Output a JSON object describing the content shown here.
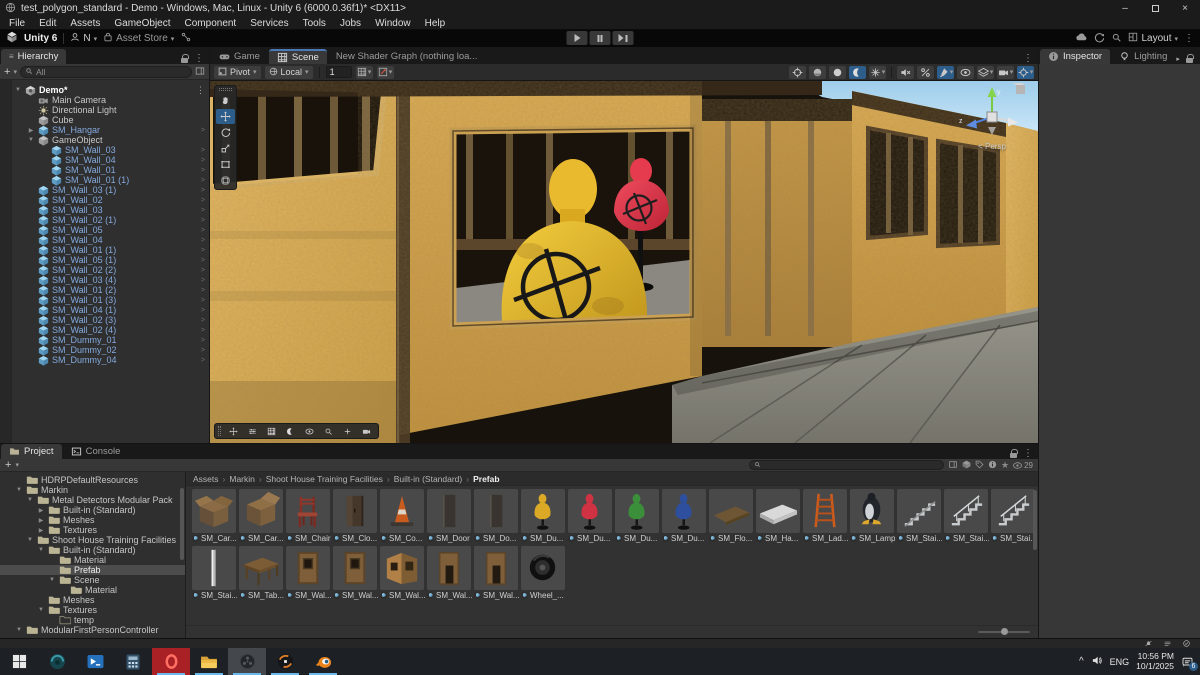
{
  "window": {
    "title": "test_polygon_standard - Demo - Windows, Mac, Linux - Unity 6 (6000.0.36f1)* <DX11>"
  },
  "menu": [
    "File",
    "Edit",
    "Assets",
    "GameObject",
    "Component",
    "Services",
    "Tools",
    "Jobs",
    "Window",
    "Help"
  ],
  "topbar": {
    "product": "Unity 6",
    "account_initial": "N",
    "asset_store_label": "Asset Store",
    "layout_label": "Layout"
  },
  "glyphs": {
    "caret": "▾",
    "kebab": "⋮",
    "menu_lines": "≡",
    "plus": "+",
    "chev": ">",
    "crumb_sep": "›",
    "minimize": "–",
    "close": "×",
    "expand_open": "▼",
    "expand_closed": "▶",
    "arrow_right_small": "▸",
    "tray_chevron": "^",
    "star": "★"
  },
  "colors": {
    "accent_blue": "#2d5d8b",
    "prefab_text": "#84aade",
    "selection_gray": "#4c4c4c",
    "osb_wood": "#d8a94f",
    "dummy_yellow": "#e8b92e",
    "dummy_red": "#e23a4c",
    "taskbar_underline": "#6cb8e8",
    "opera_red": "#a92025",
    "sky": "#a8d4ee"
  },
  "hierarchy": {
    "tab": "Hierarchy",
    "search_filter": "All",
    "rows": [
      {
        "label": "Demo*",
        "depth": 0,
        "kind": "scene",
        "exp": "open"
      },
      {
        "label": "Main Camera",
        "depth": 1,
        "kind": "camera"
      },
      {
        "label": "Directional Light",
        "depth": 1,
        "kind": "light"
      },
      {
        "label": "Cube",
        "depth": 1,
        "kind": "cube"
      },
      {
        "label": "SM_Hangar",
        "depth": 1,
        "kind": "prefab",
        "exp": "closed"
      },
      {
        "label": "GameObject",
        "depth": 1,
        "kind": "cube",
        "exp": "open"
      },
      {
        "label": "SM_Wall_03",
        "depth": 2,
        "kind": "prefab"
      },
      {
        "label": "SM_Wall_04",
        "depth": 2,
        "kind": "prefab"
      },
      {
        "label": "SM_Wall_01",
        "depth": 2,
        "kind": "prefab"
      },
      {
        "label": "SM_Wall_01 (1)",
        "depth": 2,
        "kind": "prefab"
      },
      {
        "label": "SM_Wall_03 (1)",
        "depth": 1,
        "kind": "prefab"
      },
      {
        "label": "SM_Wall_02",
        "depth": 1,
        "kind": "prefab"
      },
      {
        "label": "SM_Wall_03",
        "depth": 1,
        "kind": "prefab"
      },
      {
        "label": "SM_Wall_02 (1)",
        "depth": 1,
        "kind": "prefab"
      },
      {
        "label": "SM_Wall_05",
        "depth": 1,
        "kind": "prefab"
      },
      {
        "label": "SM_Wall_04",
        "depth": 1,
        "kind": "prefab"
      },
      {
        "label": "SM_Wall_01 (1)",
        "depth": 1,
        "kind": "prefab"
      },
      {
        "label": "SM_Wall_05 (1)",
        "depth": 1,
        "kind": "prefab"
      },
      {
        "label": "SM_Wall_02 (2)",
        "depth": 1,
        "kind": "prefab"
      },
      {
        "label": "SM_Wall_03 (4)",
        "depth": 1,
        "kind": "prefab"
      },
      {
        "label": "SM_Wall_01 (2)",
        "depth": 1,
        "kind": "prefab"
      },
      {
        "label": "SM_Wall_01 (3)",
        "depth": 1,
        "kind": "prefab"
      },
      {
        "label": "SM_Wall_04 (1)",
        "depth": 1,
        "kind": "prefab"
      },
      {
        "label": "SM_Wall_02 (3)",
        "depth": 1,
        "kind": "prefab"
      },
      {
        "label": "SM_Wall_02 (4)",
        "depth": 1,
        "kind": "prefab"
      },
      {
        "label": "SM_Dummy_01",
        "depth": 1,
        "kind": "prefab"
      },
      {
        "label": "SM_Dummy_02",
        "depth": 1,
        "kind": "prefab"
      },
      {
        "label": "SM_Dummy_04",
        "depth": 1,
        "kind": "prefab"
      }
    ]
  },
  "scene": {
    "tabs": [
      {
        "label": "Game",
        "icon": "game"
      },
      {
        "label": "Scene",
        "icon": "scenegrid",
        "active": true
      },
      {
        "label": "New Shader Graph (nothing loa...",
        "icon": ""
      }
    ],
    "pivot": "Pivot",
    "local": "Local",
    "snap": "1",
    "persp": "< Persp",
    "axis_y": "y",
    "axis_z": "z",
    "tools": [
      {
        "icon": "hand",
        "name": "view-tool"
      },
      {
        "icon": "move",
        "name": "move-tool",
        "active": true
      },
      {
        "icon": "rotate",
        "name": "rotate-tool"
      },
      {
        "icon": "scale",
        "name": "scale-tool"
      },
      {
        "icon": "rectt",
        "name": "rect-tool"
      },
      {
        "icon": "transform",
        "name": "transform-tool"
      }
    ],
    "right_icons": [
      {
        "icon": "crosshair",
        "name": "frame-debug-toggle"
      },
      {
        "icon": "sphere",
        "name": "shading-mode-toggle"
      },
      {
        "icon": "circle",
        "name": "light-probe-toggle"
      },
      {
        "icon": "moon",
        "name": "scene-lighting-toggle",
        "active": true
      },
      {
        "icon": "starfx",
        "name": "effects-toggle",
        "dd": true
      },
      {
        "sep": true
      },
      {
        "icon": "mute",
        "name": "audio-toggle"
      },
      {
        "icon": "cutoff",
        "name": "component-cull-toggle"
      },
      {
        "icon": "brush",
        "name": "overlay-paint-toggle",
        "active": true,
        "dd": true
      },
      {
        "icon": "eye",
        "name": "scene-visibility-toggle"
      },
      {
        "icon": "layers",
        "name": "layers-menu",
        "dd": true
      },
      {
        "icon": "camera",
        "name": "camera-settings-menu",
        "dd": true
      },
      {
        "icon": "gizmodot",
        "name": "gizmos-menu",
        "active": true,
        "dd": true
      }
    ],
    "bottom_icons": [
      {
        "icon": "move",
        "name": "overlay-move"
      },
      {
        "icon": "sliders",
        "name": "overlay-properties"
      },
      {
        "icon": "grid",
        "name": "overlay-grid"
      },
      {
        "icon": "moon",
        "name": "overlay-lighting"
      },
      {
        "icon": "eye",
        "name": "overlay-visibility"
      },
      {
        "icon": "magnifier",
        "name": "overlay-zoom"
      },
      {
        "icon": "pan",
        "name": "overlay-pan"
      },
      {
        "icon": "camera",
        "name": "overlay-camera"
      }
    ]
  },
  "inspector": {
    "tabs": [
      {
        "label": "Inspector",
        "icon": "info",
        "active": true
      },
      {
        "label": "Lighting",
        "icon": "bulb"
      }
    ]
  },
  "project": {
    "tabs": [
      {
        "label": "Project",
        "icon": "folder",
        "active": true
      },
      {
        "label": "Console",
        "icon": "console"
      }
    ],
    "hidden_count": "29",
    "breadcrumb": [
      "Assets",
      "Markin",
      "Shoot House Training Facilities",
      "Built-in (Standard)",
      "Prefab"
    ],
    "tree": [
      {
        "label": "HDRPDefaultResources",
        "depth": 1,
        "kind": "folder"
      },
      {
        "label": "Markin",
        "depth": 1,
        "kind": "folder",
        "exp": "open"
      },
      {
        "label": "Metal Detectors Modular Pack",
        "depth": 2,
        "kind": "folder",
        "exp": "open"
      },
      {
        "label": "Built-in (Standard)",
        "depth": 3,
        "kind": "folder",
        "exp": "closed"
      },
      {
        "label": "Meshes",
        "depth": 3,
        "kind": "folder",
        "exp": "closed"
      },
      {
        "label": "Textures",
        "depth": 3,
        "kind": "folder",
        "exp": "closed"
      },
      {
        "label": "Shoot House Training Facilities",
        "depth": 2,
        "kind": "folder",
        "exp": "open"
      },
      {
        "label": "Built-in (Standard)",
        "depth": 3,
        "kind": "folder",
        "exp": "open"
      },
      {
        "label": "Material",
        "depth": 4,
        "kind": "folder"
      },
      {
        "label": "Prefab",
        "depth": 4,
        "kind": "folder",
        "selected": true
      },
      {
        "label": "Scene",
        "depth": 4,
        "kind": "folder",
        "exp": "open"
      },
      {
        "label": "Material",
        "depth": 5,
        "kind": "folder"
      },
      {
        "label": "Meshes",
        "depth": 3,
        "kind": "folder"
      },
      {
        "label": "Textures",
        "depth": 3,
        "kind": "folder",
        "exp": "open"
      },
      {
        "label": "temp",
        "depth": 4,
        "kind": "folder-empty"
      },
      {
        "label": "ModularFirstPersonController",
        "depth": 1,
        "kind": "folder",
        "exp": "open"
      }
    ],
    "grid": [
      [
        {
          "label": "SM_Car...",
          "kind": "box-open"
        },
        {
          "label": "SM_Car...",
          "kind": "box-flaps"
        },
        {
          "label": "SM_Chair",
          "kind": "chair"
        },
        {
          "label": "SM_Clo...",
          "kind": "closet"
        },
        {
          "label": "SM_Co...",
          "kind": "cone"
        },
        {
          "label": "SM_Door",
          "kind": "door"
        },
        {
          "label": "SM_Do...",
          "kind": "door"
        },
        {
          "label": "SM_Du...",
          "kind": "dummy-yellow"
        },
        {
          "label": "SM_Du...",
          "kind": "dummy-red"
        },
        {
          "label": "SM_Du...",
          "kind": "dummy-green"
        },
        {
          "label": "SM_Du...",
          "kind": "dummy-blue"
        },
        {
          "label": "SM_Flo...",
          "kind": "floorp"
        },
        {
          "label": "SM_Ha...",
          "kind": "platform"
        },
        {
          "label": "SM_Lad...",
          "kind": "ladder"
        },
        {
          "label": "SM_Lamp",
          "kind": "lamp"
        },
        {
          "label": "SM_Stai...",
          "kind": "stairs"
        },
        {
          "label": "SM_Stai...",
          "kind": "stairs-rail"
        },
        {
          "label": "SM_Stai...",
          "kind": "stairs-rail"
        }
      ],
      [
        {
          "label": "SM_Stai...",
          "kind": "pole"
        },
        {
          "label": "SM_Tab...",
          "kind": "table"
        },
        {
          "label": "SM_Wal...",
          "kind": "wall-window"
        },
        {
          "label": "SM_Wal...",
          "kind": "wall-window"
        },
        {
          "label": "SM_Wal...",
          "kind": "wall-corner"
        },
        {
          "label": "SM_Wal...",
          "kind": "wall-door"
        },
        {
          "label": "SM_Wal...",
          "kind": "wall-door"
        },
        {
          "label": "Wheel_...",
          "kind": "wheel"
        }
      ]
    ]
  },
  "status_icons": [
    {
      "icon": "bell-slash",
      "name": "notifications-muted-icon"
    },
    {
      "icon": "stack",
      "name": "background-tasks-icon"
    },
    {
      "icon": "check-circle",
      "name": "status-ok-icon"
    }
  ],
  "taskbar": {
    "lang": "ENG",
    "time": "10:56 PM",
    "date": "10/1/2025",
    "badge": "6",
    "apps": [
      {
        "name": "start"
      },
      {
        "name": "round-app"
      },
      {
        "name": "powershell"
      },
      {
        "name": "calculator"
      },
      {
        "name": "opera",
        "running": true,
        "bg": "red"
      },
      {
        "name": "explorer",
        "running": true
      },
      {
        "name": "unity-hub",
        "running": true,
        "bg": "gray"
      },
      {
        "name": "unity-editor",
        "running": true
      },
      {
        "name": "blender",
        "running": true
      }
    ]
  }
}
